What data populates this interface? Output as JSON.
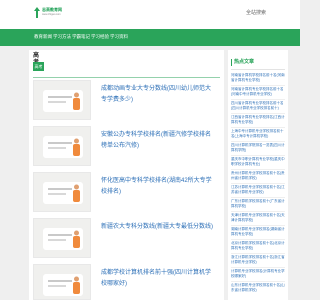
{
  "header": {
    "logo_text": "志高教育网",
    "logo_sub": "www.zhigao.com",
    "search_label": "全站搜索"
  },
  "nav": {
    "items": [
      {
        "label": "教育新闻"
      },
      {
        "label": "学习方法"
      },
      {
        "label": "学霸笔记"
      },
      {
        "label": "学习经验"
      },
      {
        "label": "学习资料"
      }
    ]
  },
  "section": {
    "title": "高考",
    "tag": "高考"
  },
  "articles": [
    {
      "title": "成都动画专业大专分数线(四川幼儿师范大专学费多少)",
      "date": ""
    },
    {
      "title": "安徽公办专科学校排名(新疆汽修学校排名榜单公布汽修)",
      "date": ""
    },
    {
      "title": "怀化医高中专科学校排名(湖南42所大专学校排名)",
      "date": ""
    },
    {
      "title": "新疆农大专科分数线(新疆大专最低分数线)",
      "date": ""
    },
    {
      "title": "成都学校计算机排名前十强(四川计算机学校哪家好)",
      "date": ""
    }
  ],
  "sidebar": {
    "title": "热点文章",
    "items": [
      "河南省计算机学校排名前十名(河南省计算机专业学校)",
      "河南省计算机专业学校排名前十名(河南中专计算机专业学校)",
      "四川省计算机专业学校排名前十名(四川计算机专业学校排名前十)",
      "江西省计算机专业学校排名(江西计算机专业学校)",
      "上海中专计算机专业学校排名前十名(上海中专计算机学校)",
      "四川计算机学院排名一览表(四川计算机学院)",
      "重庆市中职计算机专业学校(重庆中职学校计算机专业)",
      "贵州计算机专业学校排名前十名(贵州省计算机学校)",
      "江苏计算机专业学校排名前十名(江苏省计算机专业学校)",
      "广东计算机学校排名前十(广东省计算机学校)",
      "天津计算机专业学校排名前十名(天津计算机学校)",
      "湖南计算机专业学校排名(湖南省计算机专业学校)",
      "北京计算机学校排名前十名(北京计算机专业学校)",
      "浙江计算机学校排名前十名(浙江省计算机专业学校)",
      "计算机专业学校排名(计算机专业学校哪家好)",
      "山东计算机专业学校排名前十名(山东省计算机学校)"
    ]
  },
  "colors": {
    "brand_green": "#2aa45a",
    "link_blue": "#2c6fb7"
  }
}
